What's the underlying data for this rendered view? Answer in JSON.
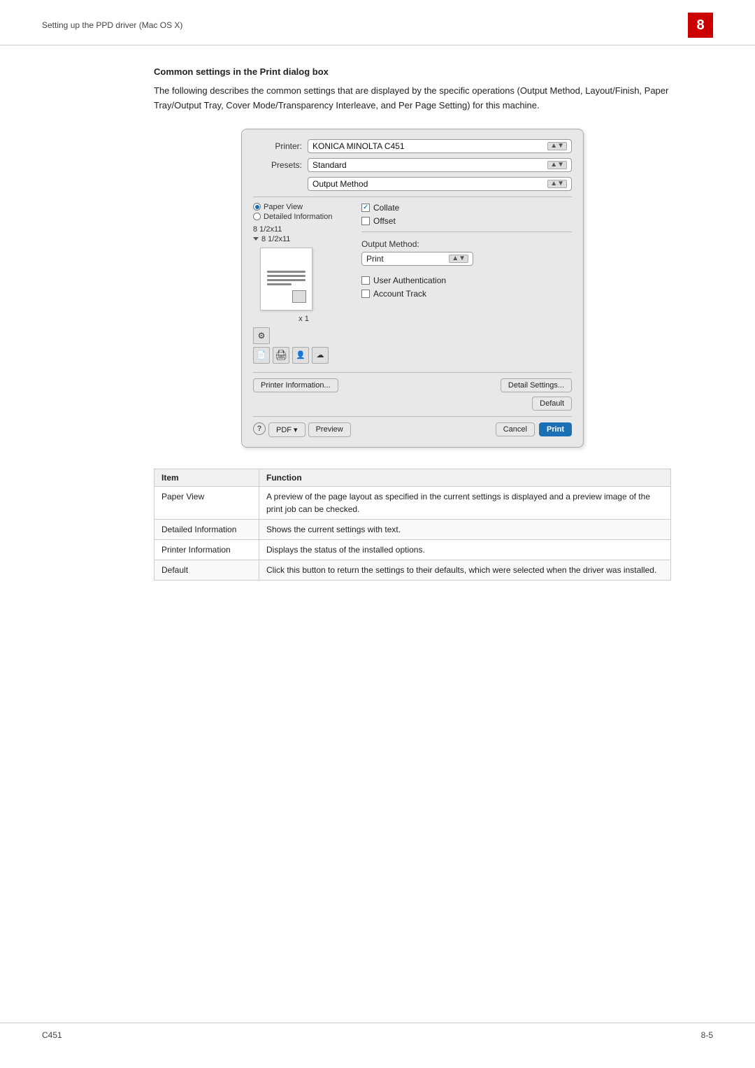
{
  "header": {
    "title": "Setting up the PPD driver (Mac OS X)",
    "page_number": "8"
  },
  "section": {
    "title": "Common settings in the Print dialog box",
    "intro": "The following describes the common settings that are displayed by the specific operations (Output Method, Layout/Finish, Paper Tray/Output Tray, Cover Mode/Transparency Interleave, and Per Page Setting) for this machine."
  },
  "dialog": {
    "printer_label": "Printer:",
    "printer_value": "KONICA MINOLTA C451",
    "presets_label": "Presets:",
    "presets_value": "Standard",
    "dropdown_value": "Output Method",
    "radio_paper_view": "Paper View",
    "radio_detailed": "Detailed Information",
    "size1": "8 1/2x11",
    "size2": "8 1/2x11",
    "x1": "x 1",
    "collate_label": "Collate",
    "offset_label": "Offset",
    "output_method_label": "Output Method:",
    "output_method_value": "Print",
    "user_auth_label": "User Authentication",
    "account_track_label": "Account Track",
    "printer_info_btn": "Printer Information...",
    "detail_settings_btn": "Detail Settings...",
    "default_btn": "Default",
    "cancel_btn": "Cancel",
    "print_btn": "Print",
    "pdf_btn": "PDF ▾",
    "preview_btn": "Preview"
  },
  "table": {
    "col_item": "Item",
    "col_function": "Function",
    "rows": [
      {
        "item": "Paper View",
        "function": "A preview of the page layout as specified in the current settings is displayed and a preview image of the print job can be checked."
      },
      {
        "item": "Detailed Information",
        "function": "Shows the current settings with text."
      },
      {
        "item": "Printer Information",
        "function": "Displays the status of the installed options."
      },
      {
        "item": "Default",
        "function": "Click this button to return the settings to their defaults, which were selected when the driver was installed."
      }
    ]
  },
  "footer": {
    "left": "C451",
    "right": "8-5"
  }
}
